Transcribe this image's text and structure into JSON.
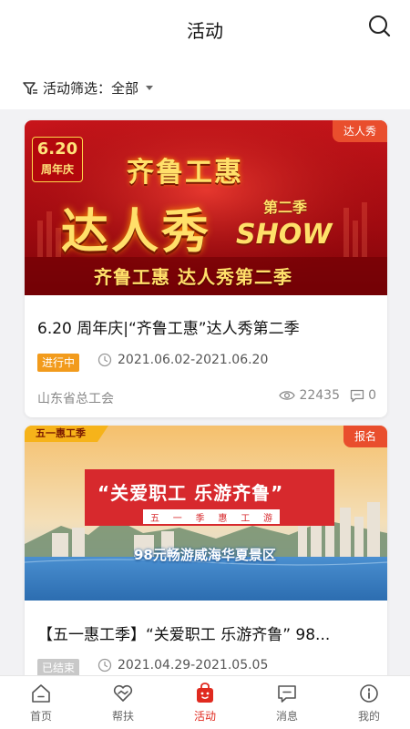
{
  "header": {
    "title": "活动"
  },
  "filter": {
    "label": "活动筛选：",
    "value": "全部"
  },
  "activities": [
    {
      "tag": "达人秀",
      "banner": {
        "badge_top": "6.20",
        "badge_bottom": "周年庆",
        "line1": "齐鲁工惠",
        "line2": "达人秀",
        "season": "第二季",
        "show": "SHOW",
        "subline": "齐鲁工惠 达人秀第二季"
      },
      "title": "6.20 周年庆|“齐鲁工惠”达人秀第二季",
      "status": "进行中",
      "date_range": "2021.06.02-2021.06.20",
      "organizer": "山东省总工会",
      "views": "22435",
      "comments": "0"
    },
    {
      "tag": "报名",
      "banner": {
        "ribbon": "五一惠工季",
        "headline": "“关爱职工 乐游齐鲁”",
        "subchips": [
          "五",
          "一",
          "季",
          "惠",
          "工",
          "游"
        ],
        "caption": "98元畅游威海华夏景区"
      },
      "title": "【五一惠工季】“关爱职工 乐游齐鲁” 98...",
      "status": "已结束",
      "date_range": "2021.04.29-2021.05.05"
    }
  ],
  "tabbar": [
    {
      "label": "首页",
      "icon": "home-icon"
    },
    {
      "label": "帮扶",
      "icon": "heart-hands-icon"
    },
    {
      "label": "活动",
      "icon": "activity-bag-icon",
      "active": true
    },
    {
      "label": "消息",
      "icon": "message-icon"
    },
    {
      "label": "我的",
      "icon": "profile-icon"
    }
  ],
  "colors": {
    "accent": "#e02a1f",
    "tag": "#e94e2d",
    "ongoing": "#f29b1c",
    "ended": "#c8c8c8"
  }
}
